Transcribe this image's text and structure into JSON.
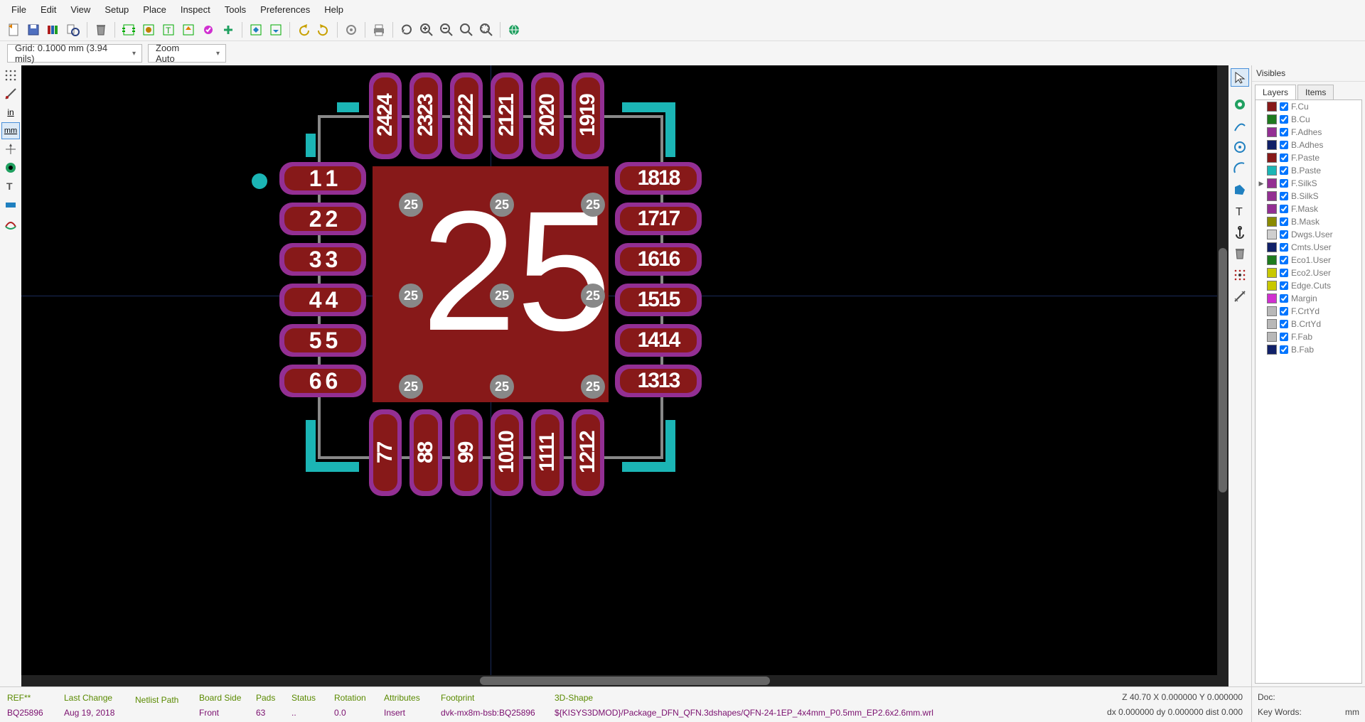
{
  "menu": [
    "File",
    "Edit",
    "View",
    "Setup",
    "Place",
    "Inspect",
    "Tools",
    "Preferences",
    "Help"
  ],
  "combo": {
    "grid": "Grid: 0.1000 mm (3.94 mils)",
    "zoom": "Zoom Auto"
  },
  "leftTools": {
    "in": "in",
    "mm": "mm"
  },
  "visibles": {
    "title": "Visibles",
    "tabs": [
      "Layers",
      "Items"
    ],
    "layers": [
      {
        "c": "#871919",
        "n": "F.Cu",
        "a": false
      },
      {
        "c": "#1e7a1e",
        "n": "B.Cu",
        "a": false
      },
      {
        "c": "#932f93",
        "n": "F.Adhes",
        "a": false
      },
      {
        "c": "#102068",
        "n": "B.Adhes",
        "a": false
      },
      {
        "c": "#871919",
        "n": "F.Paste",
        "a": false
      },
      {
        "c": "#1bb5b5",
        "n": "B.Paste",
        "a": false
      },
      {
        "c": "#932f93",
        "n": "F.SilkS",
        "a": true
      },
      {
        "c": "#932f93",
        "n": "B.SilkS",
        "a": false
      },
      {
        "c": "#932f93",
        "n": "F.Mask",
        "a": false
      },
      {
        "c": "#8a8a00",
        "n": "B.Mask",
        "a": false
      },
      {
        "c": "#cfcfcf",
        "n": "Dwgs.User",
        "a": false
      },
      {
        "c": "#102068",
        "n": "Cmts.User",
        "a": false
      },
      {
        "c": "#1e7a1e",
        "n": "Eco1.User",
        "a": false
      },
      {
        "c": "#c8c800",
        "n": "Eco2.User",
        "a": false
      },
      {
        "c": "#c8c800",
        "n": "Edge.Cuts",
        "a": false
      },
      {
        "c": "#d030d0",
        "n": "Margin",
        "a": false
      },
      {
        "c": "#b8b8b8",
        "n": "F.CrtYd",
        "a": false
      },
      {
        "c": "#b8b8b8",
        "n": "B.CrtYd",
        "a": false
      },
      {
        "c": "#b8b8b8",
        "n": "F.Fab",
        "a": false
      },
      {
        "c": "#102068",
        "n": "B.Fab",
        "a": false
      }
    ]
  },
  "status": {
    "ref_l": "REF**",
    "ref_v": "BQ25896",
    "lc_l": "Last Change",
    "lc_v": "Aug 19, 2018",
    "np_l": "Netlist Path",
    "np_v": "",
    "bs_l": "Board Side",
    "bs_v": "Front",
    "pd_l": "Pads",
    "pd_v": "63",
    "st_l": "Status",
    "st_v": "..",
    "rt_l": "Rotation",
    "rt_v": "0.0",
    "at_l": "Attributes",
    "at_v": "Insert",
    "fp_l": "Footprint",
    "fp_v": "dvk-mx8m-bsb:BQ25896",
    "sh_l": "3D-Shape",
    "sh_v": "${KISYS3DMOD}/Package_DFN_QFN.3dshapes/QFN-24-1EP_4x4mm_P0.5mm_EP2.6x2.6mm.wrl",
    "coords1": "Z 40.70    X 0.000000  Y 0.000000",
    "coords2": "dx 0.000000  dy 0.000000  dist 0.000",
    "doc": "Doc:",
    "kw": "Key Words:",
    "mm": "mm"
  },
  "footprint": {
    "centerLabel": "25",
    "left": [
      "1",
      "2",
      "3",
      "4",
      "5",
      "6"
    ],
    "right": [
      "18",
      "17",
      "16",
      "15",
      "14",
      "13"
    ],
    "top": [
      "24",
      "23",
      "22",
      "21",
      "20",
      "19"
    ],
    "bottom": [
      "7",
      "8",
      "9",
      "10",
      "11",
      "12"
    ],
    "via": "25"
  }
}
